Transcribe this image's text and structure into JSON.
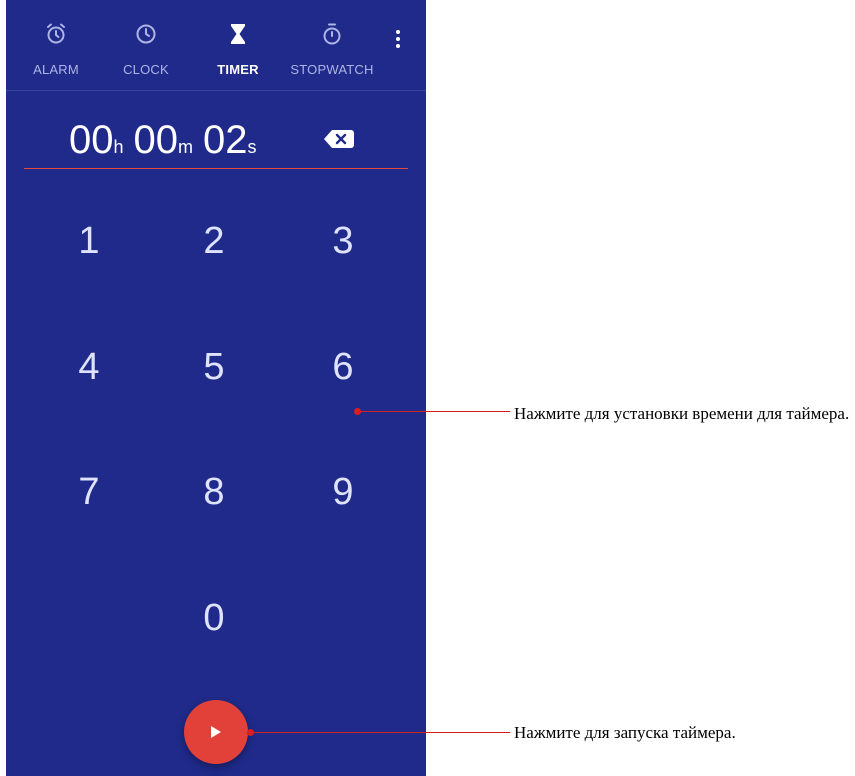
{
  "tabs": [
    {
      "label": "ALARM",
      "icon": "alarm-icon"
    },
    {
      "label": "CLOCK",
      "icon": "clock-icon"
    },
    {
      "label": "TIMER",
      "icon": "hourglass-icon"
    },
    {
      "label": "STOPWATCH",
      "icon": "stopwatch-icon"
    }
  ],
  "active_tab": "TIMER",
  "timer": {
    "hours": "00",
    "hours_unit": "h",
    "minutes": "00",
    "minutes_unit": "m",
    "seconds": "02",
    "seconds_unit": "s"
  },
  "keypad": [
    "1",
    "2",
    "3",
    "4",
    "5",
    "6",
    "7",
    "8",
    "9",
    "0"
  ],
  "annotations": {
    "set_time": "Нажмите для установки времени для таймера.",
    "start": "Нажмите для запуска таймера."
  },
  "colors": {
    "background": "#1f2a8a",
    "accent": "#e2413a",
    "callout_line": "#d81e1e"
  }
}
